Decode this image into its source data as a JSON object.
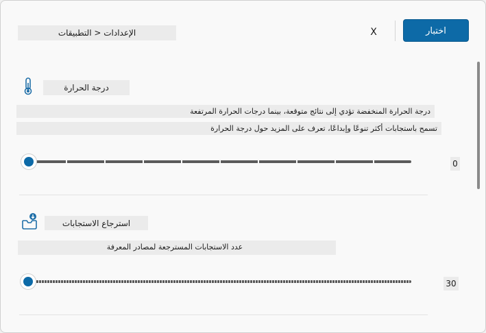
{
  "header": {
    "breadcrumb": "الإعدادات < التطبيقات",
    "close_label": "X",
    "test_button_label": "اختبار"
  },
  "sections": [
    {
      "icon": "thermometer-icon",
      "title": "درجة الحرارة",
      "description_line1": "درجة الحرارة المنخفضة تؤدي إلى نتائج متوقعة، بينما درجات الحرارة المرتفعة",
      "description_line2": "تسمح باستجابات أكثر تنوعًا وإبداعًا، تعرف على المزيد حول درجة الحرارة",
      "slider_value": 0,
      "slider_fraction": 0.0,
      "value_label": "0"
    },
    {
      "icon": "inbox-download-icon",
      "title": "استرجاع الاستجابات",
      "description_line1": "عدد الاستجابات المسترجعة لمصادر المعرفة",
      "slider_value": 30,
      "slider_fraction": 0.0,
      "value_label": "30"
    }
  ],
  "colors": {
    "accent": "#0d6aa7",
    "track": "#5a5a5a"
  }
}
